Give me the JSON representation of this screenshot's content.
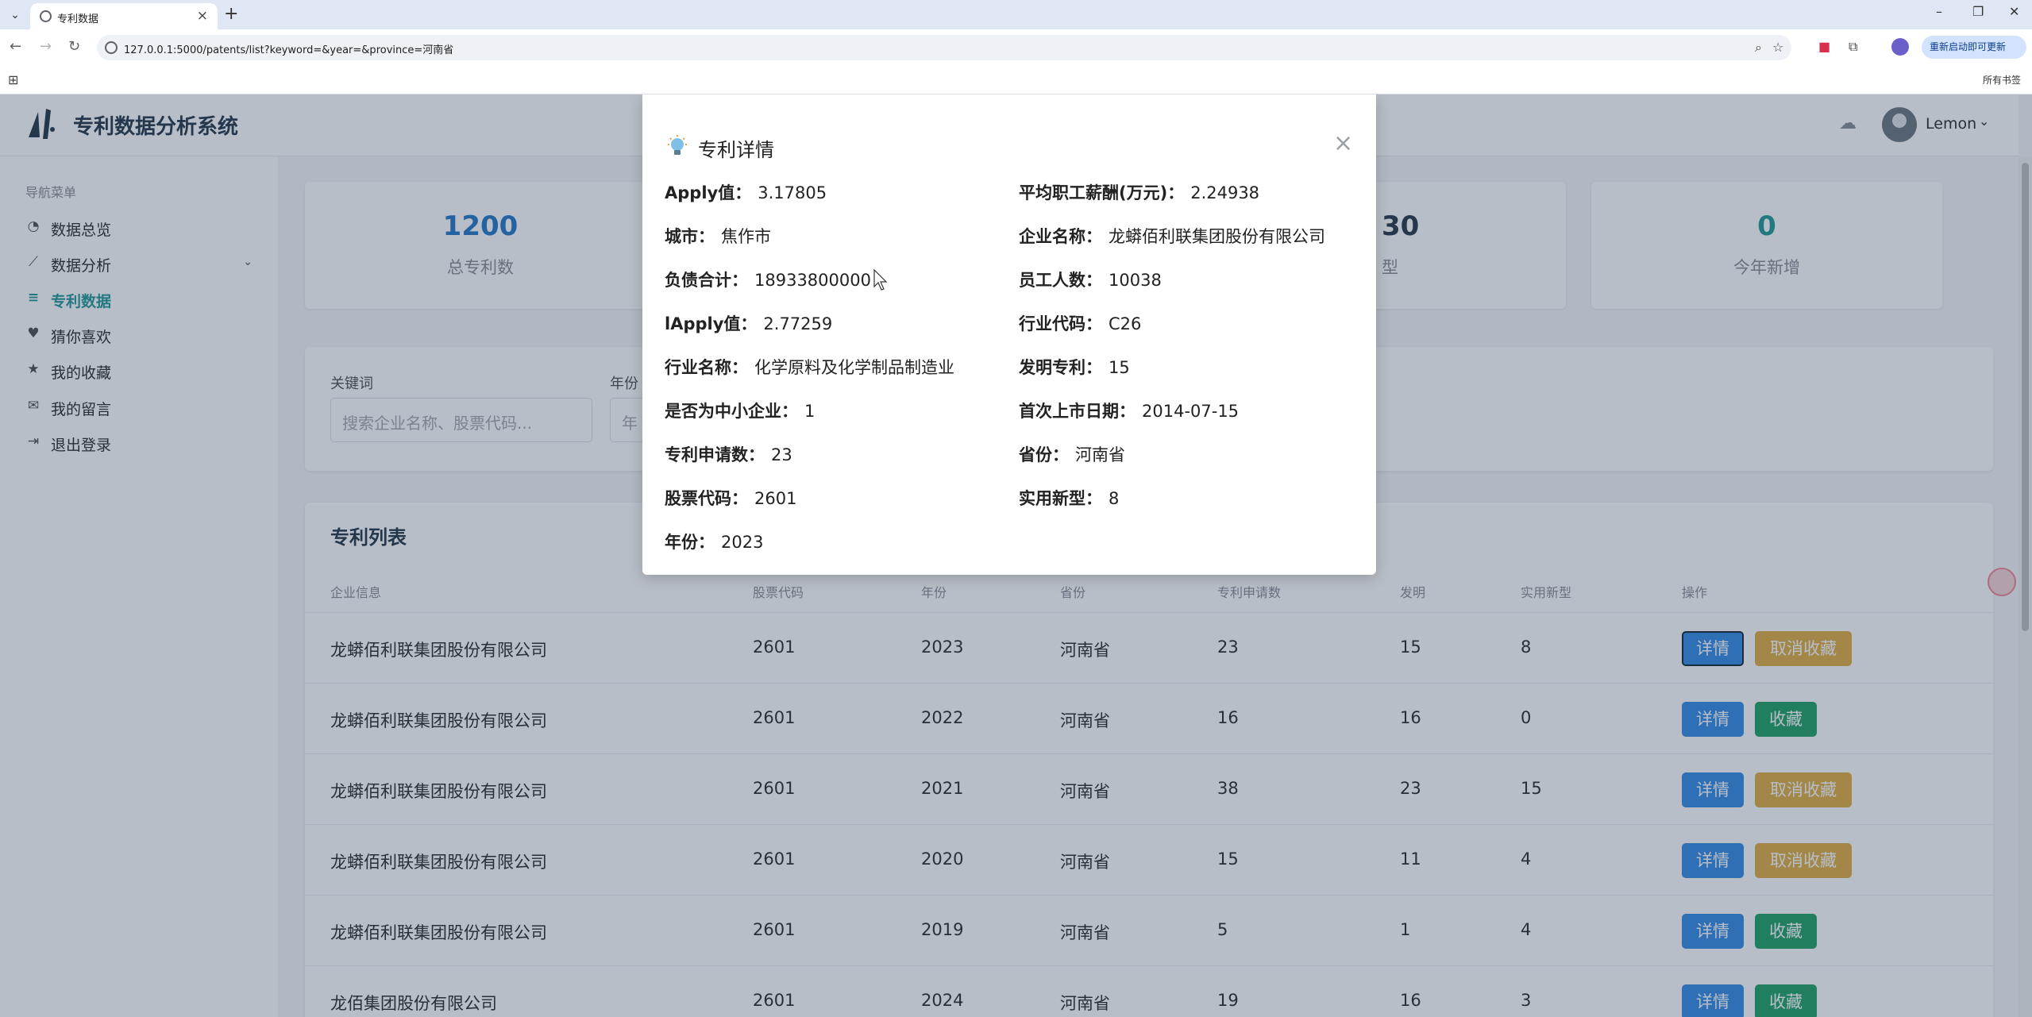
{
  "browser": {
    "tab_title": "专利数据",
    "url": "127.0.0.1:5000/patents/list?keyword=&year=&province=河南省",
    "update_button": "重新启动即可更新",
    "bookmarks_all": "所有书签"
  },
  "app": {
    "title": "专利数据分析系统",
    "user": "Lemon"
  },
  "sidebar": {
    "heading": "导航菜单",
    "items": [
      {
        "label": "数据总览",
        "icon": "pie-chart-icon"
      },
      {
        "label": "数据分析",
        "icon": "line-chart-icon"
      },
      {
        "label": "专利数据",
        "icon": "database-icon",
        "active": true
      },
      {
        "label": "猜你喜欢",
        "icon": "heart-icon"
      },
      {
        "label": "我的收藏",
        "icon": "star-icon"
      },
      {
        "label": "我的留言",
        "icon": "comments-icon"
      },
      {
        "label": "退出登录",
        "icon": "logout-icon"
      }
    ]
  },
  "stats": [
    {
      "value": "1200",
      "label": "总专利数"
    },
    {
      "value": "30",
      "label": "型"
    },
    {
      "value": "0",
      "label": "今年新增"
    }
  ],
  "search": {
    "keyword_label": "关键词",
    "keyword_placeholder": "搜索企业名称、股票代码...",
    "year_label": "年份",
    "year_placeholder": "年"
  },
  "list": {
    "title": "专利列表",
    "columns": [
      "企业信息",
      "股票代码",
      "年份",
      "省份",
      "专利申请数",
      "发明",
      "实用新型",
      "操作"
    ],
    "rows": [
      {
        "company": "龙蟒佰利联集团股份有限公司",
        "code": "2601",
        "year": "2023",
        "province": "河南省",
        "apply": "23",
        "invent": "15",
        "utility": "8",
        "detail": "详情",
        "fav": "取消收藏"
      },
      {
        "company": "龙蟒佰利联集团股份有限公司",
        "code": "2601",
        "year": "2022",
        "province": "河南省",
        "apply": "16",
        "invent": "16",
        "utility": "0",
        "detail": "详情",
        "fav": "收藏"
      },
      {
        "company": "龙蟒佰利联集团股份有限公司",
        "code": "2601",
        "year": "2021",
        "province": "河南省",
        "apply": "38",
        "invent": "23",
        "utility": "15",
        "detail": "详情",
        "fav": "取消收藏"
      },
      {
        "company": "龙蟒佰利联集团股份有限公司",
        "code": "2601",
        "year": "2020",
        "province": "河南省",
        "apply": "15",
        "invent": "11",
        "utility": "4",
        "detail": "详情",
        "fav": "取消收藏"
      },
      {
        "company": "龙蟒佰利联集团股份有限公司",
        "code": "2601",
        "year": "2019",
        "province": "河南省",
        "apply": "5",
        "invent": "1",
        "utility": "4",
        "detail": "详情",
        "fav": "收藏"
      },
      {
        "company": "龙佰集团股份有限公司",
        "code": "2601",
        "year": "2024",
        "province": "河南省",
        "apply": "19",
        "invent": "16",
        "utility": "3",
        "detail": "详情",
        "fav": "收藏"
      }
    ]
  },
  "modal": {
    "title": "专利详情",
    "left": [
      {
        "k": "Apply值：",
        "v": "3.17805"
      },
      {
        "k": "城市：",
        "v": "焦作市"
      },
      {
        "k": "负债合计：",
        "v": "18933800000"
      },
      {
        "k": "lApply值：",
        "v": "2.77259"
      },
      {
        "k": "行业名称：",
        "v": "化学原料及化学制品制造业"
      },
      {
        "k": "是否为中小企业：",
        "v": "1"
      },
      {
        "k": "专利申请数：",
        "v": "23"
      },
      {
        "k": "股票代码：",
        "v": "2601"
      },
      {
        "k": "年份：",
        "v": "2023"
      }
    ],
    "right": [
      {
        "k": "平均职工薪酬(万元)：",
        "v": "2.24938"
      },
      {
        "k": "企业名称：",
        "v": "龙蟒佰利联集团股份有限公司"
      },
      {
        "k": "员工人数：",
        "v": "10038"
      },
      {
        "k": "行业代码：",
        "v": "C26"
      },
      {
        "k": "发明专利：",
        "v": "15"
      },
      {
        "k": "首次上市日期：",
        "v": "2014-07-15"
      },
      {
        "k": "省份：",
        "v": "河南省"
      },
      {
        "k": "实用新型：",
        "v": "8"
      }
    ]
  },
  "colors": {
    "accent": "#2a9d9d",
    "detail_button": "#3a8ee6",
    "fav_button": "#27a56a",
    "unfav_button": "#e0b04a"
  }
}
